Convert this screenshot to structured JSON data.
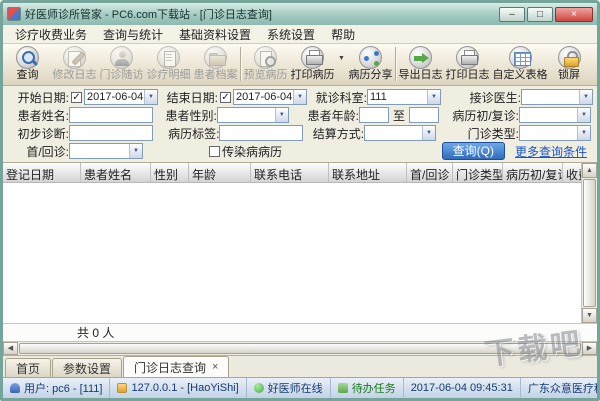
{
  "window": {
    "title": "好医师诊所管家 - PC6.com下载站 - [门诊日志查询]",
    "controls": {
      "minimize": "–",
      "maximize": "□",
      "close": "×"
    }
  },
  "menu": {
    "items": [
      {
        "label": "诊疗收费业务"
      },
      {
        "label": "查询与统计"
      },
      {
        "label": "基础资料设置"
      },
      {
        "label": "系统设置"
      },
      {
        "label": "帮助"
      }
    ]
  },
  "toolbar": {
    "buttons": [
      {
        "label": "查询",
        "icon": "search-icon",
        "disabled": false
      },
      {
        "label": "修改日志",
        "icon": "edit-log-icon",
        "disabled": true
      },
      {
        "label": "门诊随访",
        "icon": "followup-icon",
        "disabled": true
      },
      {
        "label": "诊疗明细",
        "icon": "treatment-detail-icon",
        "disabled": true
      },
      {
        "label": "患者档案",
        "icon": "patient-archive-icon",
        "disabled": true
      },
      {
        "label": "预览病历",
        "icon": "preview-record-icon",
        "disabled": true
      },
      {
        "label": "打印病历",
        "icon": "print-record-icon",
        "disabled": false
      },
      {
        "label": "病历分享",
        "icon": "share-record-icon",
        "disabled": false
      },
      {
        "label": "导出日志",
        "icon": "export-log-icon",
        "disabled": false
      },
      {
        "label": "打印日志",
        "icon": "print-log-icon",
        "disabled": false
      },
      {
        "label": "自定义表格",
        "icon": "custom-table-icon",
        "disabled": false
      },
      {
        "label": "锁屏",
        "icon": "lock-screen-icon",
        "disabled": false
      }
    ],
    "dropdown_glyph": "▼"
  },
  "filters": {
    "start_date": {
      "label": "开始日期:",
      "checked": true,
      "value": "2017-06-04"
    },
    "end_date": {
      "label": "结束日期:",
      "checked": true,
      "value": "2017-06-04"
    },
    "department": {
      "label": "就诊科室:",
      "value": "111"
    },
    "doctor": {
      "label": "接诊医生:",
      "value": ""
    },
    "patient_name": {
      "label": "患者姓名:",
      "value": ""
    },
    "patient_gender": {
      "label": "患者性别:",
      "value": ""
    },
    "patient_age": {
      "label": "患者年龄:",
      "from": "",
      "range_separator": "至",
      "to": ""
    },
    "record_visit": {
      "label": "病历初/复诊:",
      "value": ""
    },
    "initial_diagnosis": {
      "label": "初步诊断:",
      "value": ""
    },
    "record_tag": {
      "label": "病历标签:",
      "value": ""
    },
    "settlement": {
      "label": "结算方式:",
      "value": ""
    },
    "outpatient_type": {
      "label": "门诊类型:",
      "value": ""
    },
    "first_return": {
      "label": "首/回诊:",
      "value": ""
    },
    "infectious": {
      "label": "传染病病历",
      "checked": false
    },
    "query_button": {
      "label": "查询(Q)"
    },
    "more_link": {
      "label": "更多查询条件"
    }
  },
  "grid": {
    "columns": [
      {
        "label": "登记日期"
      },
      {
        "label": "患者姓名"
      },
      {
        "label": "性别"
      },
      {
        "label": "年龄"
      },
      {
        "label": "联系电话"
      },
      {
        "label": "联系地址"
      },
      {
        "label": "首/回诊"
      },
      {
        "label": "门诊类型"
      },
      {
        "label": "病历初/复诊"
      },
      {
        "label": "收费金额"
      }
    ],
    "rows": [],
    "summary": "共 0 人"
  },
  "tabs": {
    "items": [
      {
        "label": "首页",
        "active": false
      },
      {
        "label": "参数设置",
        "active": false
      },
      {
        "label": "门诊日志查询",
        "active": true,
        "close_glyph": "×"
      }
    ]
  },
  "statusbar": {
    "user": "用户: pc6 - [111]",
    "server": "127.0.0.1 - [HaoYiShi]",
    "online": "好医师在线",
    "tasks": "待办任务",
    "datetime": "2017-06-04 09:45:31",
    "company": "广东众意医疗科技有限公司"
  },
  "watermark": "下载吧"
}
